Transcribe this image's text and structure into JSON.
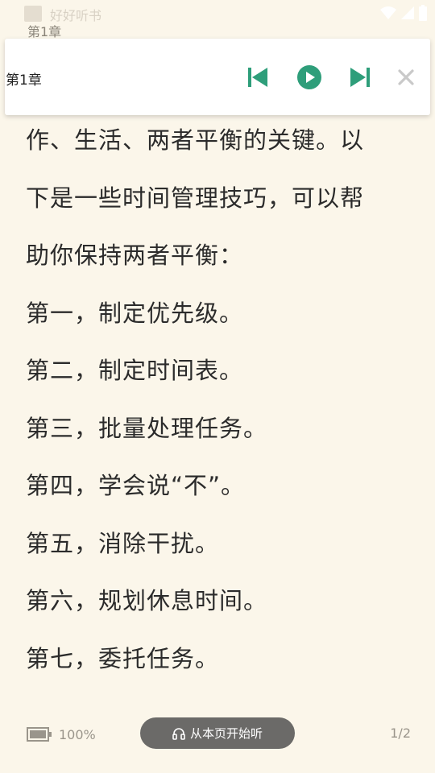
{
  "status_bar": {
    "app_name": "好好听书",
    "icons": [
      "wifi-icon",
      "signal-icon",
      "battery-icon"
    ]
  },
  "chapter_header": "第1章",
  "tts_panel": {
    "title": "第1章",
    "controls": {
      "prev": "skip-previous-icon",
      "play": "play-icon",
      "next": "skip-next-icon",
      "close": "close-icon"
    },
    "accent_color": "#2e9e7a"
  },
  "content": {
    "lines": [
      "作、生活、两者平衡的关键。以",
      "下是一些时间管理技巧，可以帮",
      "助你保持两者平衡：",
      "第一，制定优先级。",
      "第二，制定时间表。",
      "第三，批量处理任务。",
      "第四，学会说“不”。",
      "第五，消除干扰。",
      "第六，规划休息时间。",
      "第七，委托任务。"
    ]
  },
  "footer": {
    "battery_text": "100%",
    "listen_button_label": "从本页开始听",
    "page_indicator": "1/2"
  }
}
